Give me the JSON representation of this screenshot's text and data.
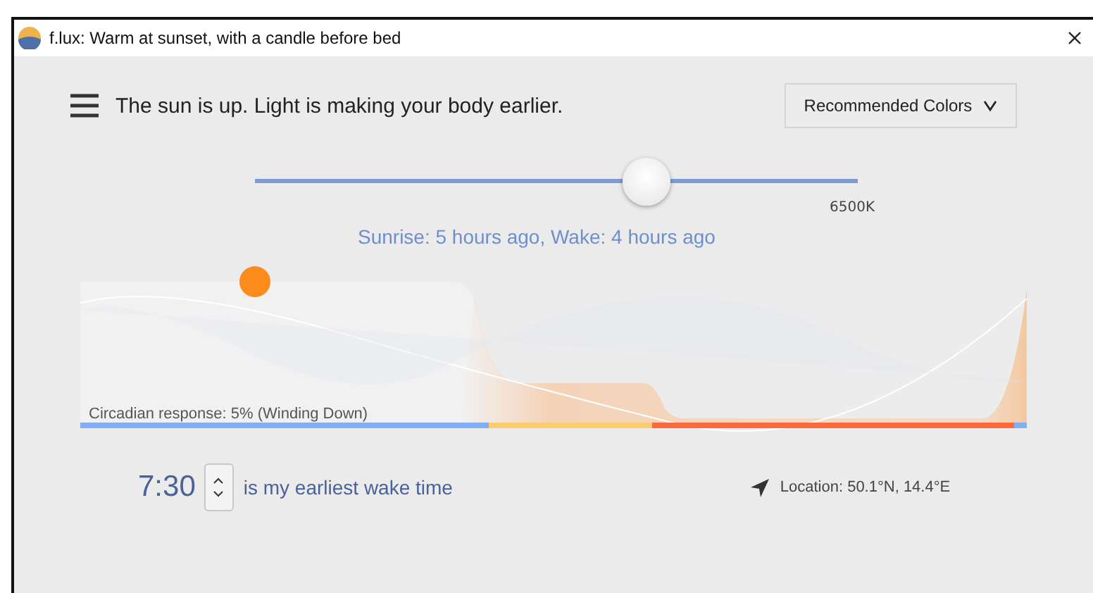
{
  "window": {
    "title": "f.lux: Warm at sunset, with a candle before bed"
  },
  "status": {
    "message": "The sun is up. Light is making your body earlier."
  },
  "preset_dropdown": {
    "value": "Recommended Colors"
  },
  "color_slider": {
    "level": 0.65,
    "reading": "6500K"
  },
  "sun_info": "Sunrise: 5 hours ago, Wake: 4 hours ago",
  "schedule": {
    "caption": "Circadian response: 5% (Winding Down)"
  },
  "wake": {
    "time": "7:30",
    "label": "is my earliest wake time"
  },
  "location": "Location: 50.1°N, 14.4°E"
}
